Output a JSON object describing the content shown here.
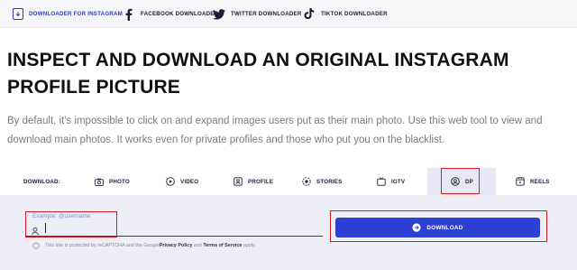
{
  "nav": {
    "items": [
      {
        "label": "DOWNLOADER FOR INSTAGRAM",
        "icon": "download-box-icon",
        "active": true
      },
      {
        "label": "FACEBOOK DOWNLOADER",
        "icon": "facebook-icon"
      },
      {
        "label": "TWITTER DOWNLOADER",
        "icon": "twitter-icon"
      },
      {
        "label": "TIKTOK DOWNLOADER",
        "icon": "tiktok-icon"
      }
    ]
  },
  "main": {
    "title": "INSPECT AND DOWNLOAD AN ORIGINAL INSTAGRAM PROFILE PICTURE",
    "description": "By default, it's impossible to click on and expand images users put as their main photo. Use this web tool to view and download main photos. It works even for private profiles and those who put you on the blacklist."
  },
  "tabs": {
    "label": "DOWNLOAD:",
    "items": [
      {
        "label": "PHOTO",
        "icon": "camera-icon"
      },
      {
        "label": "VIDEO",
        "icon": "play-circle-icon"
      },
      {
        "label": "PROFILE",
        "icon": "profile-card-icon"
      },
      {
        "label": "STORIES",
        "icon": "stories-icon"
      },
      {
        "label": "IGTV",
        "icon": "tv-icon"
      },
      {
        "label": "DP",
        "icon": "user-circle-icon",
        "active": true
      },
      {
        "label": "REELS",
        "icon": "reels-icon"
      }
    ]
  },
  "form": {
    "input_label": "Example: @username",
    "input_value": "",
    "download_label": "DOWNLOAD",
    "recaptcha_prefix": "This site is protected by reCAPTCHA and the Google ",
    "privacy_label": "Privacy Policy",
    "and_label": " and ",
    "terms_label": "Terms of Service",
    "recaptcha_suffix": " apply."
  },
  "colors": {
    "accent": "#2e40d4",
    "highlight_border": "#d71c24",
    "panel_bg": "#eeeef6"
  }
}
